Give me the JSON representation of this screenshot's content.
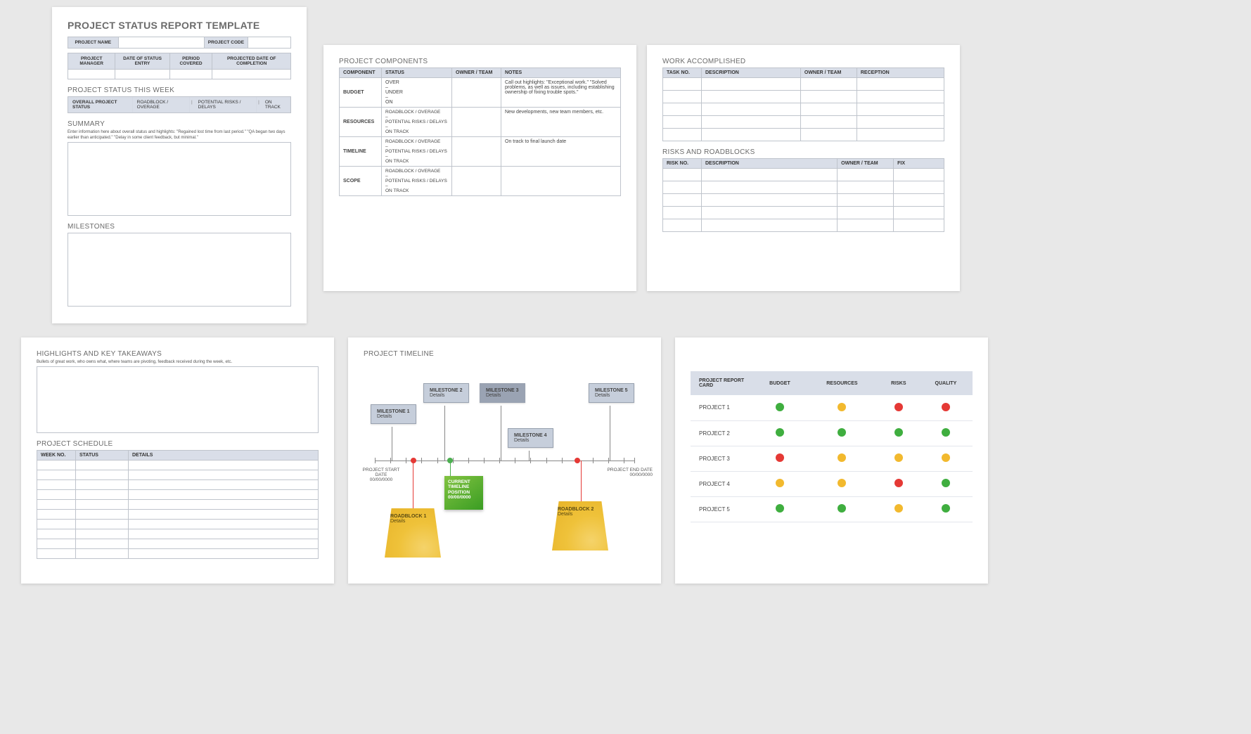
{
  "page1": {
    "title": "PROJECT STATUS REPORT TEMPLATE",
    "meta_top": {
      "name": "PROJECT NAME",
      "code": "PROJECT CODE"
    },
    "meta_cols": [
      "PROJECT MANAGER",
      "DATE OF STATUS ENTRY",
      "PERIOD COVERED",
      "PROJECTED DATE OF COMPLETION"
    ],
    "status_week_hdr": "PROJECT STATUS THIS WEEK",
    "status_bar": {
      "label": "OVERALL PROJECT STATUS",
      "opts": [
        "ROADBLOCK / OVERAGE",
        "POTENTIAL RISKS / DELAYS",
        "ON TRACK"
      ]
    },
    "summary_hdr": "SUMMARY",
    "summary_hint": "Enter information here about overall status and highlights: \"Regained lost time from last period.\" \"QA began two days earlier than anticipated.\" \"Delay in some client feedback, but minimal.\"",
    "milestones_hdr": "MILESTONES"
  },
  "page2": {
    "title": "PROJECT COMPONENTS",
    "cols": [
      "COMPONENT",
      "STATUS",
      "OWNER / TEAM",
      "NOTES"
    ],
    "rows": [
      {
        "name": "BUDGET",
        "status": "OVER\n–\nUNDER\n–\nON",
        "notes": "Call out highlights: \"Exceptional work.\" \"Solved problems, as well as issues, including establishing ownership of fixing trouble spots.\""
      },
      {
        "name": "RESOURCES",
        "status": "ROADBLOCK / OVERAGE\n–\nPOTENTIAL RISKS / DELAYS\n–\nON TRACK",
        "notes": "New developments, new team members, etc."
      },
      {
        "name": "TIMELINE",
        "status": "ROADBLOCK / OVERAGE\n–\nPOTENTIAL RISKS / DELAYS\n–\nON TRACK",
        "notes": "On track to final launch date"
      },
      {
        "name": "SCOPE",
        "status": "ROADBLOCK / OVERAGE\n–\nPOTENTIAL RISKS / DELAYS\n–\nON TRACK",
        "notes": ""
      }
    ]
  },
  "page3": {
    "work_title": "WORK ACCOMPLISHED",
    "work_cols": [
      "TASK NO.",
      "DESCRIPTION",
      "OWNER / TEAM",
      "RECEPTION"
    ],
    "risks_title": "RISKS AND ROADBLOCKS",
    "risks_cols": [
      "RISK NO.",
      "DESCRIPTION",
      "OWNER / TEAM",
      "FIX"
    ]
  },
  "page4": {
    "hdr": "HIGHLIGHTS AND KEY TAKEAWAYS",
    "hint": "Bullets of great work, who owns what, where teams are pivoting, feedback received during the week, etc.",
    "sched_hdr": "PROJECT SCHEDULE",
    "sched_cols": [
      "WEEK NO.",
      "STATUS",
      "DETAILS"
    ]
  },
  "page5": {
    "title": "PROJECT TIMELINE",
    "milestones": [
      {
        "title": "MILESTONE 1",
        "sub": "Details"
      },
      {
        "title": "MILESTONE 2",
        "sub": "Details"
      },
      {
        "title": "MILESTONE 3",
        "sub": "Details"
      },
      {
        "title": "MILESTONE 4",
        "sub": "Details"
      },
      {
        "title": "MILESTONE 5",
        "sub": "Details"
      }
    ],
    "start": {
      "l1": "PROJECT START DATE",
      "l2": "00/00/0000"
    },
    "end": {
      "l1": "PROJECT END DATE",
      "l2": "00/00/0000"
    },
    "current": {
      "l1": "CURRENT",
      "l2": "TIMELINE",
      "l3": "POSITION",
      "l4": "00/00/0000"
    },
    "roadblocks": [
      {
        "title": "ROADBLOCK 1",
        "sub": "Details"
      },
      {
        "title": "ROADBLOCK 2",
        "sub": "Details"
      }
    ]
  },
  "page6": {
    "title": "PROJECT REPORT CARD",
    "cols": [
      "BUDGET",
      "RESOURCES",
      "RISKS",
      "QUALITY"
    ],
    "rows": [
      {
        "name": "PROJECT 1",
        "v": [
          "g",
          "y",
          "r",
          "r"
        ]
      },
      {
        "name": "PROJECT 2",
        "v": [
          "g",
          "g",
          "g",
          "g"
        ]
      },
      {
        "name": "PROJECT 3",
        "v": [
          "r",
          "y",
          "y",
          "y"
        ]
      },
      {
        "name": "PROJECT 4",
        "v": [
          "y",
          "y",
          "r",
          "g"
        ]
      },
      {
        "name": "PROJECT 5",
        "v": [
          "g",
          "g",
          "y",
          "g"
        ]
      }
    ]
  }
}
